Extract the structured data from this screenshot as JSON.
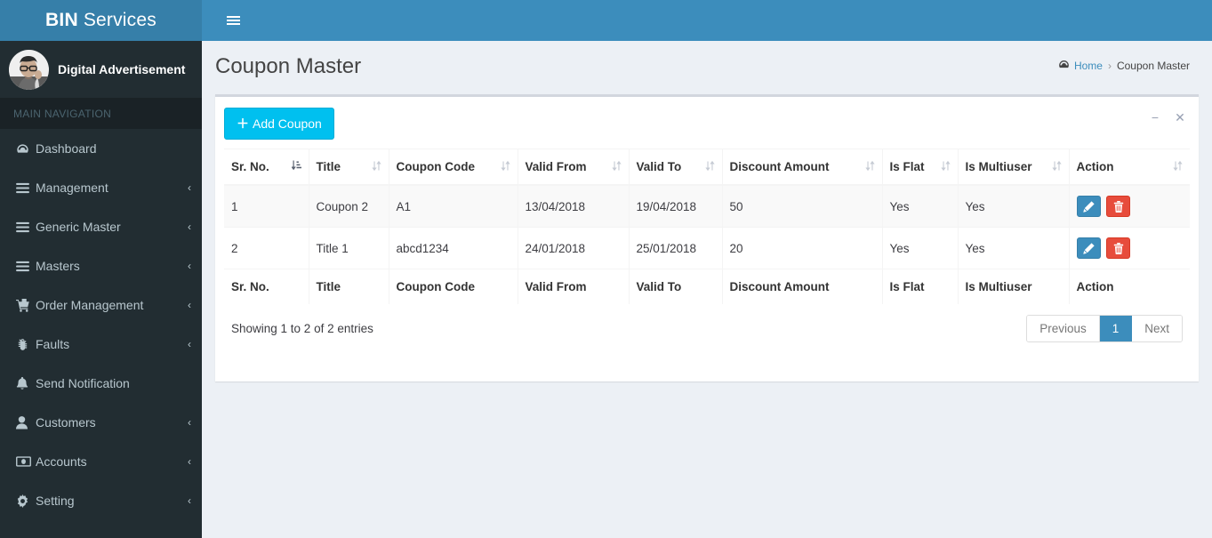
{
  "brand": {
    "bold": "BIN",
    "light": "Services"
  },
  "navbar": {
    "toggle_icon": "hamburger-icon"
  },
  "sidebar": {
    "user": {
      "name": "Digital Advertisement",
      "avatar": "user-avatar"
    },
    "nav_header": "MAIN NAVIGATION",
    "items": [
      {
        "label": "Dashboard",
        "icon": "dashboard-icon",
        "has_caret": false
      },
      {
        "label": "Management",
        "icon": "bars-icon",
        "has_caret": true
      },
      {
        "label": "Generic Master",
        "icon": "bars-icon",
        "has_caret": true
      },
      {
        "label": "Masters",
        "icon": "bars-icon",
        "has_caret": true
      },
      {
        "label": "Order Management",
        "icon": "shopping-cart-icon",
        "has_caret": true
      },
      {
        "label": "Faults",
        "icon": "bug-icon",
        "has_caret": true
      },
      {
        "label": "Send Notification",
        "icon": "bell-icon",
        "has_caret": false
      },
      {
        "label": "Customers",
        "icon": "user-icon",
        "has_caret": true
      },
      {
        "label": "Accounts",
        "icon": "money-icon",
        "has_caret": true
      },
      {
        "label": "Setting",
        "icon": "gear-icon",
        "has_caret": true
      }
    ],
    "caret": "‹"
  },
  "header": {
    "title": "Coupon Master",
    "breadcrumb": {
      "home": "Home",
      "separator": "›",
      "current": "Coupon Master"
    }
  },
  "box": {
    "add_button": "Add Coupon",
    "add_button_plus": "＋",
    "collapse_icon": "−",
    "close_icon": "✕"
  },
  "table": {
    "columns": [
      {
        "label": "Sr. No.",
        "sorted": true
      },
      {
        "label": "Title",
        "sorted": false
      },
      {
        "label": "Coupon Code",
        "sorted": false
      },
      {
        "label": "Valid From",
        "sorted": false
      },
      {
        "label": "Valid To",
        "sorted": false
      },
      {
        "label": "Discount Amount",
        "sorted": false
      },
      {
        "label": "Is Flat",
        "sorted": false
      },
      {
        "label": "Is Multiuser",
        "sorted": false
      },
      {
        "label": "Action",
        "sorted": false
      }
    ],
    "rows": [
      {
        "sr_no": "1",
        "title": "Coupon 2",
        "coupon_code": "A1",
        "valid_from": "13/04/2018",
        "valid_to": "19/04/2018",
        "discount_amount": "50",
        "is_flat": "Yes",
        "is_multiuser": "Yes"
      },
      {
        "sr_no": "2",
        "title": "Title 1",
        "coupon_code": "abcd1234",
        "valid_from": "24/01/2018",
        "valid_to": "25/01/2018",
        "discount_amount": "20",
        "is_flat": "Yes",
        "is_multiuser": "Yes"
      }
    ],
    "footer_columns": [
      "Sr. No.",
      "Title",
      "Coupon Code",
      "Valid From",
      "Valid To",
      "Discount Amount",
      "Is Flat",
      "Is Multiuser",
      "Action"
    ],
    "info": "Showing 1 to 2 of 2 entries",
    "pagination": {
      "previous": "Previous",
      "pages": [
        "1"
      ],
      "next": "Next",
      "active": "1"
    },
    "row_actions": {
      "edit": "edit-icon",
      "delete": "delete-icon"
    }
  },
  "colors": {
    "navbar": "#3c8dbc",
    "logo": "#367fa9",
    "sidebar": "#222d32",
    "content_bg": "#ecf0f5",
    "add_button": "#00c0ef",
    "edit_button": "#3c8dbc",
    "delete_button": "#e74c3c",
    "pagination_active": "#3c8dbc"
  }
}
